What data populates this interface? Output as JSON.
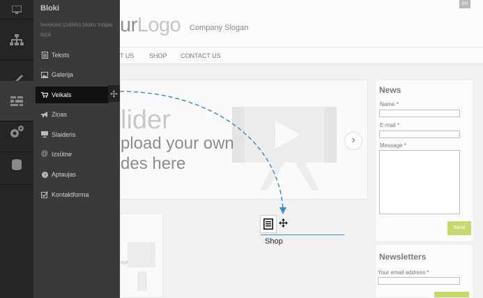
{
  "site": {
    "logo_part1": "urLogo_a",
    "logo_a": "ur",
    "logo_b": "Logo",
    "slogan": "Company Slogan",
    "lang": "EN",
    "nav": [
      "T US",
      "SHOP",
      "CONTACT US"
    ],
    "slider": {
      "line1": "lider",
      "line2": "pload your own",
      "line3": "des here",
      "next": "›"
    },
    "image_word": "age",
    "news": {
      "title": "News",
      "name_label": "Name *",
      "email_label": "E-mail *",
      "message_label": "Message *",
      "send": "Send"
    },
    "newsletters": {
      "title": "Newsletters",
      "email_label": "Your email address *"
    }
  },
  "panel": {
    "title": "Bloki",
    "description": "Ievelciet izvēlēto bloku mājas lapā",
    "items": [
      {
        "label": "Teksts",
        "icon": "document-icon"
      },
      {
        "label": "Galerija",
        "icon": "image-icon"
      },
      {
        "label": "Veikals",
        "icon": "cart-icon"
      },
      {
        "label": "Ziņas",
        "icon": "megaphone-icon"
      },
      {
        "label": "Slaideris",
        "icon": "slideshow-icon"
      },
      {
        "label": "Izsūtne",
        "icon": "at-icon"
      },
      {
        "label": "Aptaujas",
        "icon": "question-icon"
      },
      {
        "label": "Kontaktforma",
        "icon": "checkbox-icon"
      }
    ],
    "active_index": 2
  },
  "rail": [
    "monitor-icon",
    "sitemap-icon",
    "brush-icon",
    "blocks-icon",
    "gears-icon",
    "database-icon"
  ],
  "drop": {
    "label": "Shop"
  },
  "colors": {
    "accent": "#3a8fc8",
    "send": "#c6d96b",
    "panel": "#3a3a3a",
    "rail": "#252525"
  }
}
